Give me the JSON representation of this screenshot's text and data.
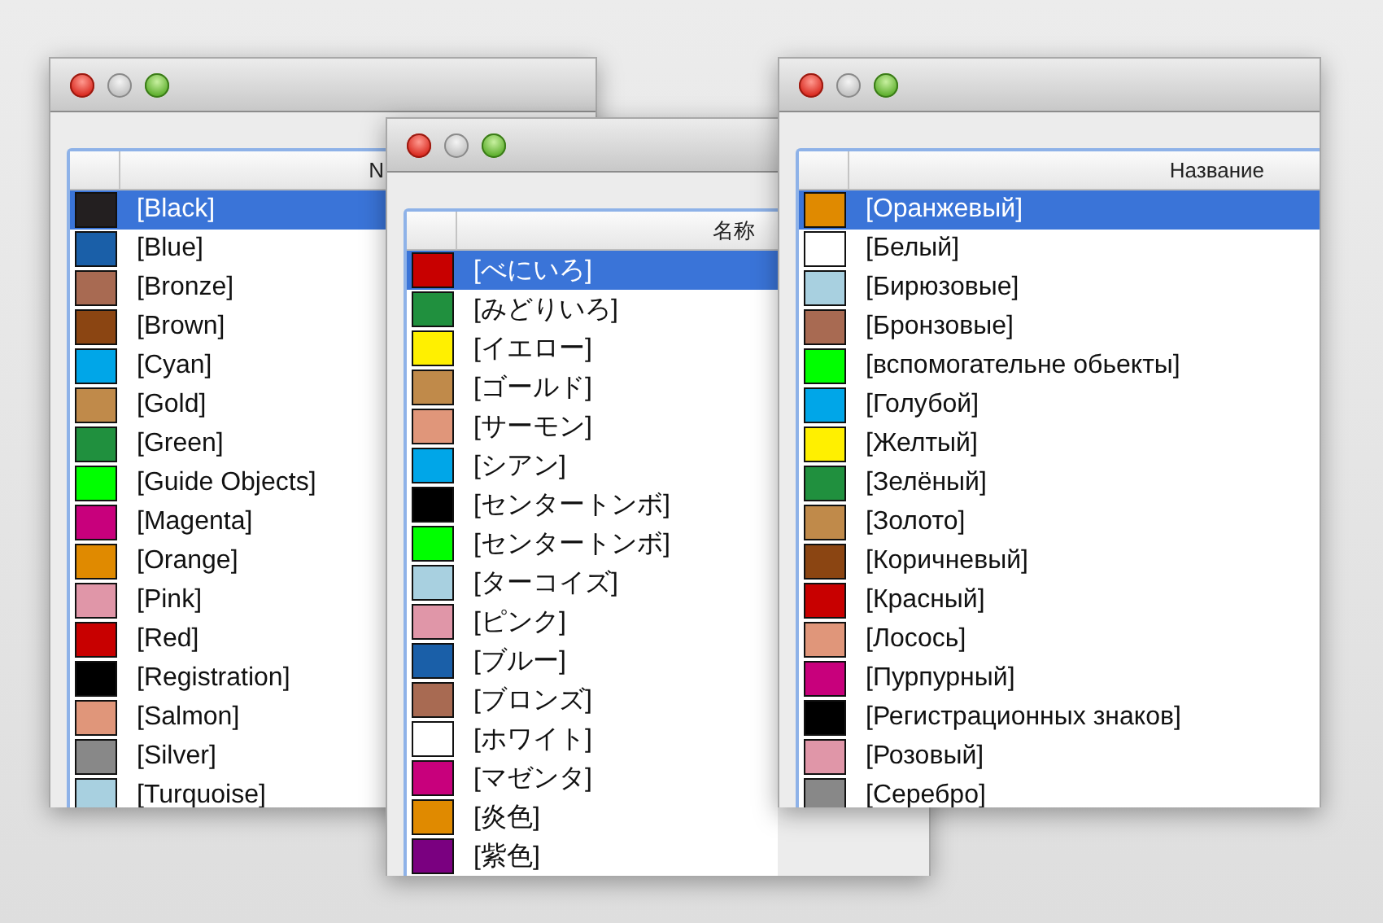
{
  "windows": [
    {
      "header": "N",
      "items": [
        {
          "label": "[Black]",
          "color": "#231f20",
          "selected": true
        },
        {
          "label": "[Blue]",
          "color": "#1a5fa8",
          "selected": false
        },
        {
          "label": "[Bronze]",
          "color": "#a86a52",
          "selected": false
        },
        {
          "label": "[Brown]",
          "color": "#8b4512",
          "selected": false
        },
        {
          "label": "[Cyan]",
          "color": "#00a6e8",
          "selected": false
        },
        {
          "label": "[Gold]",
          "color": "#c08a4a",
          "selected": false
        },
        {
          "label": "[Green]",
          "color": "#20903e",
          "selected": false
        },
        {
          "label": "[Guide Objects]",
          "color": "#00ff00",
          "selected": false
        },
        {
          "label": "[Magenta]",
          "color": "#c8007c",
          "selected": false
        },
        {
          "label": "[Orange]",
          "color": "#e08a00",
          "selected": false
        },
        {
          "label": "[Pink]",
          "color": "#e096a8",
          "selected": false
        },
        {
          "label": "[Red]",
          "color": "#c80000",
          "selected": false
        },
        {
          "label": "[Registration]",
          "color": "#000000",
          "selected": false
        },
        {
          "label": "[Salmon]",
          "color": "#e0967a",
          "selected": false
        },
        {
          "label": "[Silver]",
          "color": "#888888",
          "selected": false
        },
        {
          "label": "[Turquoise]",
          "color": "#a8d0e0",
          "selected": false
        }
      ]
    },
    {
      "header": "名称",
      "items": [
        {
          "label": "[べにいろ]",
          "color": "#c80000",
          "selected": true
        },
        {
          "label": "[みどりいろ]",
          "color": "#20903e",
          "selected": false
        },
        {
          "label": "[イエロー]",
          "color": "#fff000",
          "selected": false
        },
        {
          "label": "[ゴールド]",
          "color": "#c08a4a",
          "selected": false
        },
        {
          "label": "[サーモン]",
          "color": "#e0967a",
          "selected": false
        },
        {
          "label": "[シアン]",
          "color": "#00a6e8",
          "selected": false
        },
        {
          "label": "[センタートンボ]",
          "color": "#000000",
          "selected": false
        },
        {
          "label": "[センタートンボ]",
          "color": "#00ff00",
          "selected": false
        },
        {
          "label": "[ターコイズ]",
          "color": "#a8d0e0",
          "selected": false
        },
        {
          "label": "[ピンク]",
          "color": "#e096a8",
          "selected": false
        },
        {
          "label": "[ブルー]",
          "color": "#1a5fa8",
          "selected": false
        },
        {
          "label": "[ブロンズ]",
          "color": "#a86a52",
          "selected": false
        },
        {
          "label": "[ホワイト]",
          "color": "#ffffff",
          "selected": false
        },
        {
          "label": "[マゼンタ]",
          "color": "#c8007c",
          "selected": false
        },
        {
          "label": "[炎色]",
          "color": "#e08a00",
          "selected": false
        },
        {
          "label": "[紫色]",
          "color": "#7a0080",
          "selected": false
        }
      ]
    },
    {
      "header": "Название",
      "items": [
        {
          "label": "[Оранжевый]",
          "color": "#e08a00",
          "selected": true
        },
        {
          "label": "[Белый]",
          "color": "#ffffff",
          "selected": false
        },
        {
          "label": "[Бирюзовые]",
          "color": "#a8d0e0",
          "selected": false
        },
        {
          "label": "[Бронзовые]",
          "color": "#a86a52",
          "selected": false
        },
        {
          "label": "[вспомогательне обьекты]",
          "color": "#00ff00",
          "selected": false
        },
        {
          "label": "[Голубой]",
          "color": "#00a6e8",
          "selected": false
        },
        {
          "label": "[Желтый]",
          "color": "#fff000",
          "selected": false
        },
        {
          "label": "[Зелёный]",
          "color": "#20903e",
          "selected": false
        },
        {
          "label": "[Золото]",
          "color": "#c08a4a",
          "selected": false
        },
        {
          "label": "[Коричневый]",
          "color": "#8b4512",
          "selected": false
        },
        {
          "label": "[Красный]",
          "color": "#c80000",
          "selected": false
        },
        {
          "label": "[Лосось]",
          "color": "#e0967a",
          "selected": false
        },
        {
          "label": "[Пурпурный]",
          "color": "#c8007c",
          "selected": false
        },
        {
          "label": "[Регистрационных знаков]",
          "color": "#000000",
          "selected": false
        },
        {
          "label": "[Розовый]",
          "color": "#e096a8",
          "selected": false
        },
        {
          "label": "[Серебро]",
          "color": "#888888",
          "selected": false
        }
      ]
    }
  ]
}
